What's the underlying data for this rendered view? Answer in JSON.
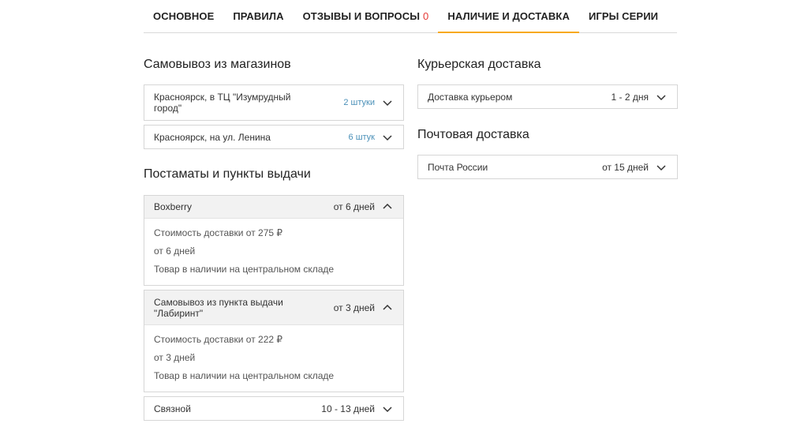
{
  "tabs": [
    {
      "label": "ОСНОВНОЕ"
    },
    {
      "label": "ПРАВИЛА"
    },
    {
      "label": "ОТЗЫВЫ И ВОПРОСЫ",
      "count": "0"
    },
    {
      "label": "НАЛИЧИЕ И ДОСТАВКА",
      "active": true
    },
    {
      "label": "ИГРЫ СЕРИИ"
    }
  ],
  "colors": {
    "accent": "#f7a91c",
    "count": "#e53935",
    "stock": "#4a90b8"
  },
  "pickup": {
    "title": "Самовывоз из магазинов",
    "stores": [
      {
        "name": "Красноярск, в ТЦ \"Изумрудный город\"",
        "stock": "2 штуки"
      },
      {
        "name": "Красноярск, на ул. Ленина",
        "stock": "6 штук"
      }
    ]
  },
  "postamats": {
    "title": "Постаматы и пункты выдачи",
    "items": [
      {
        "name": "Boxberry",
        "term": "от 6 дней",
        "details": [
          "Стоимость доставки от 275 ₽",
          "от 6 дней",
          "Товар в наличии на центральном складе"
        ]
      },
      {
        "name": "Самовывоз из пункта выдачи \"Лабиринт\"",
        "term": "от 3 дней",
        "details": [
          "Стоимость доставки от 222 ₽",
          "от 3 дней",
          "Товар в наличии на центральном складе"
        ]
      },
      {
        "name": "Связной",
        "term": "10 - 13 дней"
      }
    ]
  },
  "courier": {
    "title": "Курьерская доставка",
    "items": [
      {
        "name": "Доставка курьером",
        "term": "1 - 2 дня"
      }
    ]
  },
  "post": {
    "title": "Почтовая доставка",
    "items": [
      {
        "name": "Почта России",
        "term": "от 15 дней"
      }
    ]
  }
}
